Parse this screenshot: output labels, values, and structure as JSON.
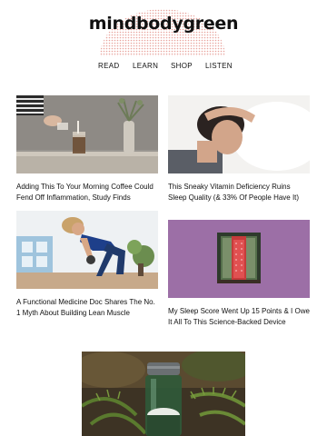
{
  "brand": {
    "logo": "mindbodygreen"
  },
  "nav": {
    "items": [
      "READ",
      "LEARN",
      "SHOP",
      "LISTEN"
    ]
  },
  "articles": [
    {
      "title": "Adding This To Your Morning Coffee Could Fend Off Inflammation, Study Finds",
      "image": "coffee-pour-photo"
    },
    {
      "title": "This Sneaky Vitamin Deficiency Ruins Sleep Quality (& 33% Of People Have It)",
      "image": "woman-in-bed-photo"
    },
    {
      "title": "A Functional Medicine Doc Shares The No. 1 Myth About Building Lean Muscle",
      "image": "woman-lifting-weights-photo"
    },
    {
      "title": "My Sleep Score Went Up 15 Points & I Owe It All To This Science-Backed Device",
      "image": "red-light-device-photo"
    }
  ],
  "featured": {
    "image": "green-bottle-in-ferns-photo"
  },
  "colors": {
    "arc": "#e8a39c",
    "purple": "#9c6fa6",
    "device_red": "#c63b3b"
  }
}
